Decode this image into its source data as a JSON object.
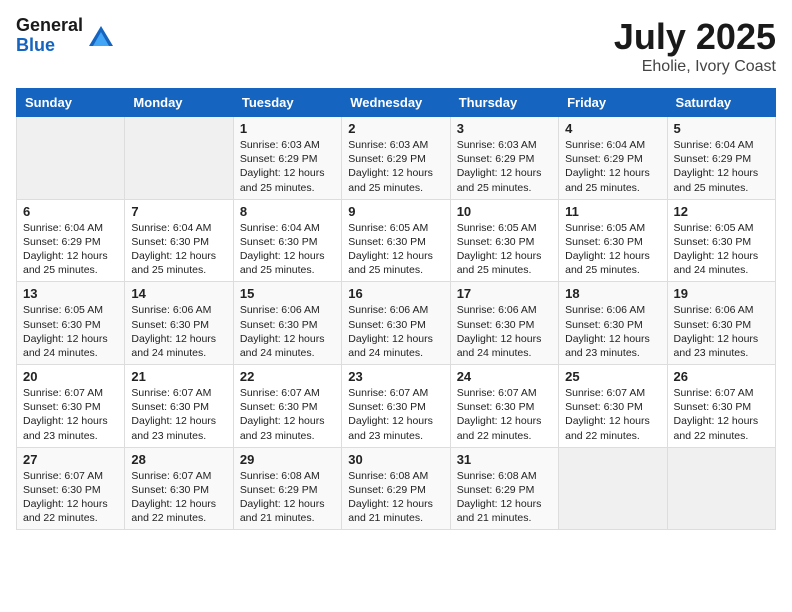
{
  "header": {
    "logo_general": "General",
    "logo_blue": "Blue",
    "month": "July 2025",
    "location": "Eholie, Ivory Coast"
  },
  "weekdays": [
    "Sunday",
    "Monday",
    "Tuesday",
    "Wednesday",
    "Thursday",
    "Friday",
    "Saturday"
  ],
  "weeks": [
    [
      {
        "day": "",
        "info": ""
      },
      {
        "day": "",
        "info": ""
      },
      {
        "day": "1",
        "info": "Sunrise: 6:03 AM\nSunset: 6:29 PM\nDaylight: 12 hours and 25 minutes."
      },
      {
        "day": "2",
        "info": "Sunrise: 6:03 AM\nSunset: 6:29 PM\nDaylight: 12 hours and 25 minutes."
      },
      {
        "day": "3",
        "info": "Sunrise: 6:03 AM\nSunset: 6:29 PM\nDaylight: 12 hours and 25 minutes."
      },
      {
        "day": "4",
        "info": "Sunrise: 6:04 AM\nSunset: 6:29 PM\nDaylight: 12 hours and 25 minutes."
      },
      {
        "day": "5",
        "info": "Sunrise: 6:04 AM\nSunset: 6:29 PM\nDaylight: 12 hours and 25 minutes."
      }
    ],
    [
      {
        "day": "6",
        "info": "Sunrise: 6:04 AM\nSunset: 6:29 PM\nDaylight: 12 hours and 25 minutes."
      },
      {
        "day": "7",
        "info": "Sunrise: 6:04 AM\nSunset: 6:30 PM\nDaylight: 12 hours and 25 minutes."
      },
      {
        "day": "8",
        "info": "Sunrise: 6:04 AM\nSunset: 6:30 PM\nDaylight: 12 hours and 25 minutes."
      },
      {
        "day": "9",
        "info": "Sunrise: 6:05 AM\nSunset: 6:30 PM\nDaylight: 12 hours and 25 minutes."
      },
      {
        "day": "10",
        "info": "Sunrise: 6:05 AM\nSunset: 6:30 PM\nDaylight: 12 hours and 25 minutes."
      },
      {
        "day": "11",
        "info": "Sunrise: 6:05 AM\nSunset: 6:30 PM\nDaylight: 12 hours and 25 minutes."
      },
      {
        "day": "12",
        "info": "Sunrise: 6:05 AM\nSunset: 6:30 PM\nDaylight: 12 hours and 24 minutes."
      }
    ],
    [
      {
        "day": "13",
        "info": "Sunrise: 6:05 AM\nSunset: 6:30 PM\nDaylight: 12 hours and 24 minutes."
      },
      {
        "day": "14",
        "info": "Sunrise: 6:06 AM\nSunset: 6:30 PM\nDaylight: 12 hours and 24 minutes."
      },
      {
        "day": "15",
        "info": "Sunrise: 6:06 AM\nSunset: 6:30 PM\nDaylight: 12 hours and 24 minutes."
      },
      {
        "day": "16",
        "info": "Sunrise: 6:06 AM\nSunset: 6:30 PM\nDaylight: 12 hours and 24 minutes."
      },
      {
        "day": "17",
        "info": "Sunrise: 6:06 AM\nSunset: 6:30 PM\nDaylight: 12 hours and 24 minutes."
      },
      {
        "day": "18",
        "info": "Sunrise: 6:06 AM\nSunset: 6:30 PM\nDaylight: 12 hours and 23 minutes."
      },
      {
        "day": "19",
        "info": "Sunrise: 6:06 AM\nSunset: 6:30 PM\nDaylight: 12 hours and 23 minutes."
      }
    ],
    [
      {
        "day": "20",
        "info": "Sunrise: 6:07 AM\nSunset: 6:30 PM\nDaylight: 12 hours and 23 minutes."
      },
      {
        "day": "21",
        "info": "Sunrise: 6:07 AM\nSunset: 6:30 PM\nDaylight: 12 hours and 23 minutes."
      },
      {
        "day": "22",
        "info": "Sunrise: 6:07 AM\nSunset: 6:30 PM\nDaylight: 12 hours and 23 minutes."
      },
      {
        "day": "23",
        "info": "Sunrise: 6:07 AM\nSunset: 6:30 PM\nDaylight: 12 hours and 23 minutes."
      },
      {
        "day": "24",
        "info": "Sunrise: 6:07 AM\nSunset: 6:30 PM\nDaylight: 12 hours and 22 minutes."
      },
      {
        "day": "25",
        "info": "Sunrise: 6:07 AM\nSunset: 6:30 PM\nDaylight: 12 hours and 22 minutes."
      },
      {
        "day": "26",
        "info": "Sunrise: 6:07 AM\nSunset: 6:30 PM\nDaylight: 12 hours and 22 minutes."
      }
    ],
    [
      {
        "day": "27",
        "info": "Sunrise: 6:07 AM\nSunset: 6:30 PM\nDaylight: 12 hours and 22 minutes."
      },
      {
        "day": "28",
        "info": "Sunrise: 6:07 AM\nSunset: 6:30 PM\nDaylight: 12 hours and 22 minutes."
      },
      {
        "day": "29",
        "info": "Sunrise: 6:08 AM\nSunset: 6:29 PM\nDaylight: 12 hours and 21 minutes."
      },
      {
        "day": "30",
        "info": "Sunrise: 6:08 AM\nSunset: 6:29 PM\nDaylight: 12 hours and 21 minutes."
      },
      {
        "day": "31",
        "info": "Sunrise: 6:08 AM\nSunset: 6:29 PM\nDaylight: 12 hours and 21 minutes."
      },
      {
        "day": "",
        "info": ""
      },
      {
        "day": "",
        "info": ""
      }
    ]
  ]
}
